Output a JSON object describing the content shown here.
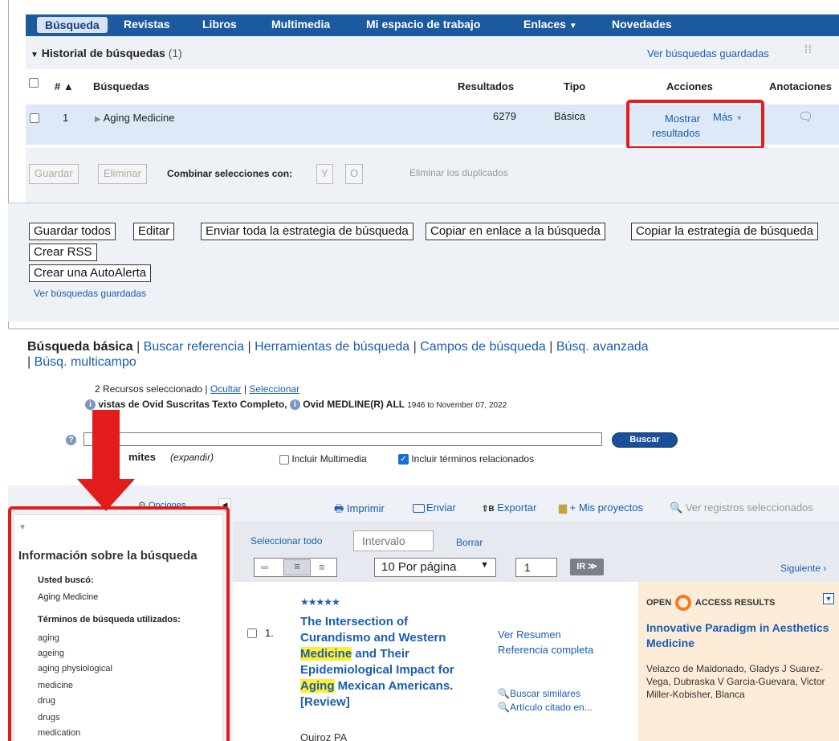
{
  "nav": {
    "tabs": [
      "Búsqueda",
      "Revistas",
      "Libros",
      "Multimedia",
      "Mi espacio de trabajo",
      "Enlaces",
      "Novedades"
    ]
  },
  "history": {
    "title": "Historial de búsquedas",
    "count": "(1)",
    "saved_link": "Ver búsquedas guardadas",
    "columns": [
      "#",
      "Búsquedas",
      "Resultados",
      "Tipo",
      "Acciones",
      "Anotaciones"
    ],
    "rows": [
      {
        "num": "1",
        "query": "Aging Medicine",
        "results": "6279",
        "type": "Básica",
        "action_show": "Mostrar",
        "action_results": "resultados",
        "action_more": "Más"
      }
    ],
    "save_btn": "Guardar",
    "delete_btn": "Eliminar",
    "combine_label": "Combinar selecciones con:",
    "combine_and": "Y",
    "combine_or": "O",
    "dedup": "Eliminar los duplicados"
  },
  "actions": {
    "save_all": "Guardar todos",
    "edit": "Editar",
    "send_strategy": "Enviar toda la estrategia de búsqueda",
    "copy_link": "Copiar en enlace a la búsqueda",
    "copy_strategy": "Copiar la estrategia de búsqueda",
    "create_rss": "Crear RSS",
    "create_alert": "Crear una AutoAlerta",
    "saved_link": "Ver búsquedas guardadas"
  },
  "search": {
    "tab_active": "Búsqueda básica",
    "tabs": [
      "Buscar referencia",
      "Herramientas de búsqueda",
      "Campos de búsqueda",
      "Búsq. avanzada",
      "Búsq. multicampo"
    ],
    "resources_text": "2 Recursos seleccionado |",
    "hide": "Ocultar",
    "select": "Seleccionar",
    "resource1": "vistas de Ovid Suscritas Texto Completo,",
    "resource2": "Ovid MEDLINE(R) ALL",
    "resource2_range": "1946 to November 07, 2022",
    "query_value": "",
    "search_btn": "Buscar",
    "limits": "mites",
    "expand": "(expandir)",
    "include_multimedia": "Incluir Multimedia",
    "include_related": "Incluir términos relacionados",
    "include_multimedia_checked": false,
    "include_related_checked": true
  },
  "results": {
    "options": "Opciones",
    "tools": [
      "Imprimir",
      "Enviar",
      "Exportar",
      "+ Mis proyectos",
      "Ver registros seleccionados"
    ],
    "select_all": "Seleccionar todo",
    "range_placeholder": "Intervalo",
    "clear": "Borrar",
    "per_page": "10 Por página",
    "page": "1",
    "go": "IR ≫",
    "next": "Siguiente ›",
    "info_title": "Información sobre la búsqueda",
    "you_searched": "Usted buscó:",
    "searched_value": "Aging Medicine",
    "terms_label": "Términos de búsqueda utilizados:",
    "terms": [
      "aging",
      "ageing",
      "aging physiological",
      "medicine",
      "drug",
      "drugs",
      "medication"
    ],
    "record": {
      "num": "1.",
      "stars": "★★★★★",
      "title_parts": [
        "The Intersection of Curandismo and Western ",
        "Medicine",
        " and Their Epidemiological Impact for ",
        "Aging",
        " Mexican Americans. [Review]"
      ],
      "author": "Quiroz PA",
      "view_abstract": "Ver Resumen",
      "full_ref": "Referencia completa",
      "similar": "Buscar similares",
      "cited": "Artículo citado en..."
    },
    "oa": {
      "label_left": "OPEN",
      "label_right": "ACCESS RESULTS",
      "title": "Innovative Paradigm in Aesthetics Medicine",
      "authors": "Velazco de Maldonado, Gladys J Suarez-Vega, Dubraska V Garcia-Guevara, Victor Miller-Kobisher, Blanca"
    }
  }
}
